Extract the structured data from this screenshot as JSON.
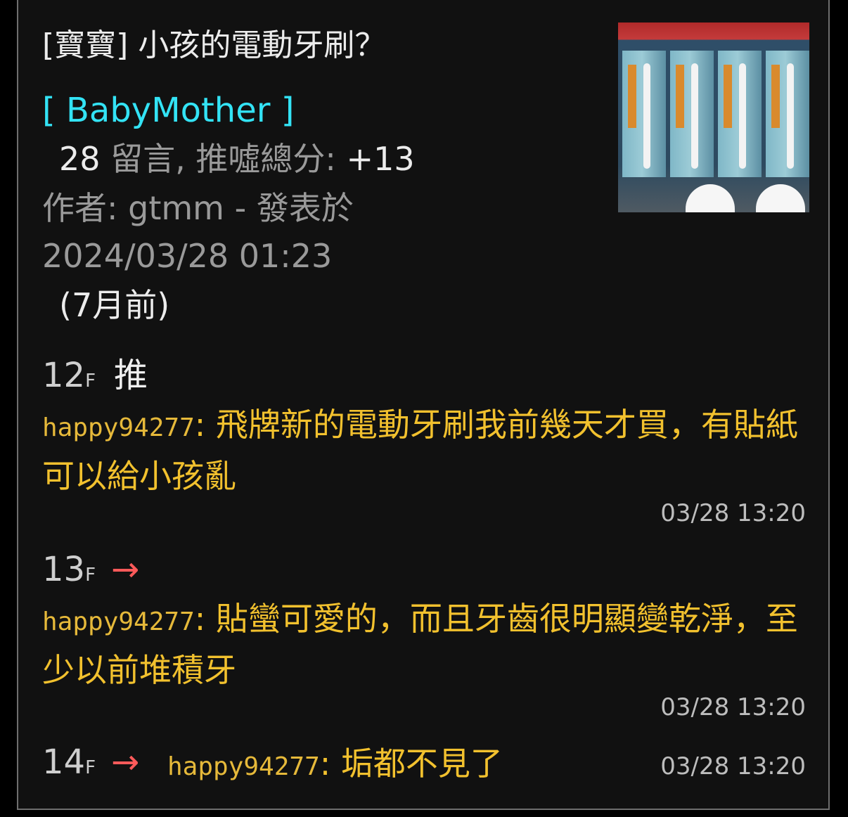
{
  "post": {
    "title": "[寶寶] 小孩的電動牙刷？",
    "board": "[ BabyMother ]",
    "comment_count": "28",
    "comment_label": "留言, 推噓總分: ",
    "score": "+13",
    "author_line": "作者: gtmm - 發表於",
    "date": "2024/03/28 01:23",
    "ago": "(7月前)",
    "thumbnail_icon": "toothbrush-photo"
  },
  "comments": [
    {
      "floor": "12",
      "floor_suffix": "F",
      "tag": "推",
      "user": "happy94277",
      "text": ": 飛牌新的電動牙刷我前幾天才買，有貼紙可以給小孩亂",
      "time": "03/28 13:20"
    },
    {
      "floor": "13",
      "floor_suffix": "F",
      "tag": "→",
      "user": "happy94277",
      "text": ": 貼蠻可愛的，而且牙齒很明顯變乾淨，至少以前堆積牙",
      "time": "03/28 13:20"
    },
    {
      "floor": "14",
      "floor_suffix": "F",
      "tag": "→",
      "user": "happy94277",
      "text": ": 垢都不見了",
      "time": "03/28 13:20"
    }
  ],
  "colors": {
    "board": "#33e3f5",
    "comment": "#f2c12e",
    "arrow": "#ff5a5a",
    "background": "#111111"
  }
}
